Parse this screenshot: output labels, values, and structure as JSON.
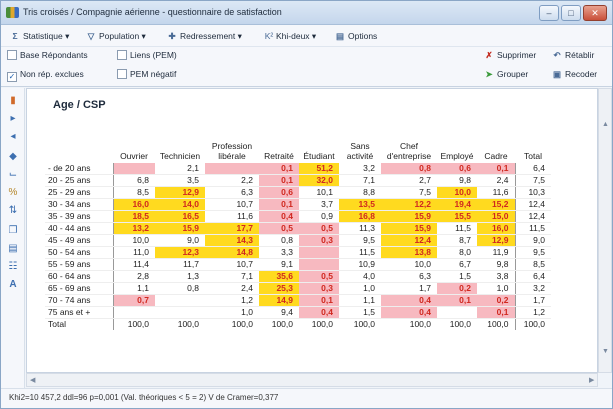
{
  "window": {
    "title": "Tris croisés / Compagnie aérienne - questionnaire de satisfaction"
  },
  "toolbar": {
    "statistique": "Statistique",
    "population": "Population",
    "redressement": "Redressement",
    "khideux": "Khi-deux",
    "options": "Options",
    "base_repondants": "Base Répondants",
    "liens_pem": "Liens (PEM)",
    "non_rep_exclues": "Non rép. exclues",
    "pem_negatif": "PEM négatif",
    "supprimer": "Supprimer",
    "retablir": "Rétablir",
    "grouper": "Grouper",
    "recoder": "Recoder"
  },
  "table": {
    "title": "Age / CSP",
    "columns": [
      "Ouvrier",
      "Technicien",
      "Profession libérale",
      "Retraité",
      "Étudiant",
      "Sans activité",
      "Chef d'entreprise",
      "Employé",
      "Cadre",
      "Total"
    ],
    "rows": [
      {
        "label": "- de 20 ans",
        "cells": [
          "",
          "2,1",
          "",
          "0,1",
          "51,2",
          "3,2",
          "0,8",
          "0,6",
          "0,1",
          "6,4"
        ],
        "hl": [
          "p",
          "",
          "p",
          "p",
          "y",
          "",
          "p",
          "p",
          "p",
          ""
        ]
      },
      {
        "label": "20 - 25 ans",
        "cells": [
          "6,8",
          "3,5",
          "2,2",
          "0,1",
          "32,0",
          "7,1",
          "2,7",
          "9,8",
          "2,4",
          "7,5"
        ],
        "hl": [
          "",
          "",
          "",
          "p",
          "y",
          "",
          "",
          "",
          "",
          ""
        ]
      },
      {
        "label": "25 - 29 ans",
        "cells": [
          "8,5",
          "12,9",
          "6,3",
          "0,6",
          "10,1",
          "8,8",
          "7,5",
          "10,0",
          "11,6",
          "10,3"
        ],
        "hl": [
          "",
          "y",
          "",
          "p",
          "",
          "",
          "",
          "y",
          "",
          ""
        ]
      },
      {
        "label": "30 - 34 ans",
        "cells": [
          "16,0",
          "14,0",
          "10,7",
          "0,1",
          "3,7",
          "13,5",
          "12,2",
          "19,4",
          "15,2",
          "12,4"
        ],
        "hl": [
          "y",
          "y",
          "",
          "p",
          "",
          "y",
          "y",
          "y",
          "y",
          ""
        ]
      },
      {
        "label": "35 - 39 ans",
        "cells": [
          "18,5",
          "16,5",
          "11,6",
          "0,4",
          "0,9",
          "16,8",
          "15,9",
          "15,5",
          "15,0",
          "12,4"
        ],
        "hl": [
          "y",
          "y",
          "",
          "p",
          "",
          "y",
          "y",
          "y",
          "y",
          ""
        ]
      },
      {
        "label": "40 - 44 ans",
        "cells": [
          "13,2",
          "15,9",
          "17,7",
          "0,5",
          "0,5",
          "11,3",
          "15,9",
          "11,5",
          "16,0",
          "11,5"
        ],
        "hl": [
          "y",
          "y",
          "y",
          "p",
          "p",
          "",
          "y",
          "",
          "y",
          ""
        ]
      },
      {
        "label": "45 - 49 ans",
        "cells": [
          "10,0",
          "9,0",
          "14,3",
          "0,8",
          "0,3",
          "9,5",
          "12,4",
          "8,7",
          "12,9",
          "9,0"
        ],
        "hl": [
          "",
          "",
          "y",
          "",
          "p",
          "",
          "y",
          "",
          "y",
          ""
        ]
      },
      {
        "label": "50 - 54 ans",
        "cells": [
          "11,0",
          "12,3",
          "14,8",
          "3,3",
          "",
          "11,5",
          "13,8",
          "8,0",
          "11,9",
          "9,5"
        ],
        "hl": [
          "",
          "y",
          "y",
          "",
          "p",
          "",
          "y",
          "",
          "",
          ""
        ]
      },
      {
        "label": "55 - 59 ans",
        "cells": [
          "11,4",
          "11,7",
          "10,7",
          "9,1",
          "",
          "10,9",
          "10,0",
          "6,7",
          "9,8",
          "8,5"
        ],
        "hl": [
          "",
          "",
          "",
          "",
          "p",
          "",
          "",
          "",
          "",
          ""
        ]
      },
      {
        "label": "60 - 64 ans",
        "cells": [
          "2,8",
          "1,3",
          "7,1",
          "35,6",
          "0,5",
          "4,0",
          "6,3",
          "1,5",
          "3,8",
          "6,4"
        ],
        "hl": [
          "",
          "",
          "",
          "y",
          "p",
          "",
          "",
          "",
          "",
          ""
        ]
      },
      {
        "label": "65 - 69 ans",
        "cells": [
          "1,1",
          "0,8",
          "2,4",
          "25,3",
          "0,3",
          "1,0",
          "1,7",
          "0,2",
          "1,0",
          "3,2"
        ],
        "hl": [
          "",
          "",
          "",
          "y",
          "p",
          "",
          "",
          "p",
          "",
          ""
        ]
      },
      {
        "label": "70 - 74 ans",
        "cells": [
          "0,7",
          "",
          "1,2",
          "14,9",
          "0,1",
          "1,1",
          "0,4",
          "0,1",
          "0,2",
          "1,7"
        ],
        "hl": [
          "p",
          "",
          "",
          "y",
          "p",
          "",
          "p",
          "p",
          "p",
          ""
        ]
      },
      {
        "label": "75 ans et +",
        "cells": [
          "",
          "",
          "1,0",
          "9,4",
          "0,4",
          "1,5",
          "0,4",
          "",
          "0,1",
          "1,2"
        ],
        "hl": [
          "",
          "",
          "",
          "",
          "p",
          "",
          "p",
          "",
          "p",
          ""
        ]
      },
      {
        "label": "Total",
        "cells": [
          "100,0",
          "100,0",
          "100,0",
          "100,0",
          "100,0",
          "100,0",
          "100,0",
          "100,0",
          "100,0",
          "100,0"
        ],
        "hl": [
          "",
          "",
          "",
          "",
          "",
          "",
          "",
          "",
          "",
          ""
        ]
      }
    ]
  },
  "status": {
    "text": "Khi2=10 457,2  ddl=96  p=0,001  (Val. théoriques < 5 = 2)  V de Cramer=0,377"
  }
}
